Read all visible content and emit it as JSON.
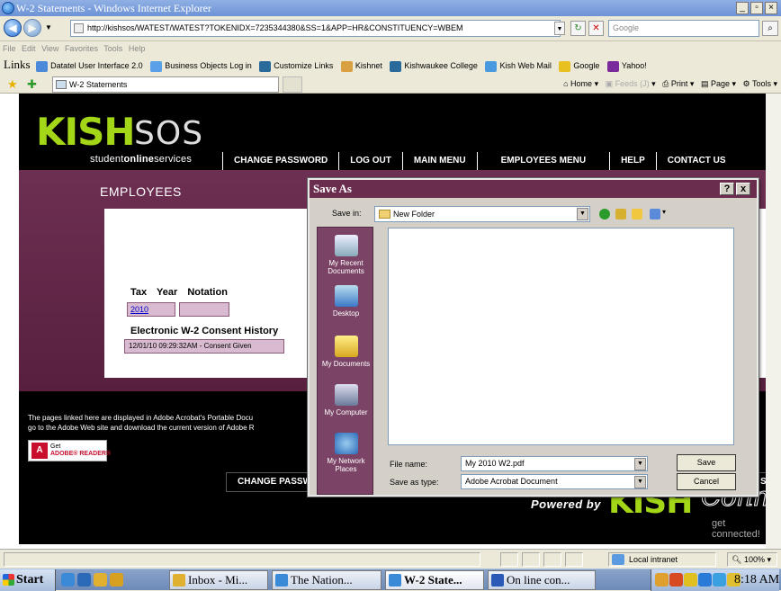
{
  "window": {
    "title": "W-2 Statements - Windows Internet Explorer",
    "controls": [
      "_",
      "̸",
      "3"
    ]
  },
  "address_bar": {
    "url": "http://kishsos/WATEST/WATEST?TOKENIDX=7235344380&SS=1&APP=HR&CONSTITUENCY=WBEM",
    "search_placeholder": "Google"
  },
  "menu": [
    "File",
    "Edit",
    "View",
    "Favorites",
    "Tools",
    "Help"
  ],
  "links_bar": {
    "label": "Links",
    "items": [
      "Datatel User Interface 2.0",
      "Business Objects Log in",
      "Customize Links",
      "Kishnet",
      "Kishwaukee College",
      "Kish Web Mail",
      "Google",
      "Yahoo!"
    ]
  },
  "tabs": {
    "active": "W-2 Statements",
    "tools": [
      "Home",
      "Feeds (J)",
      "Print",
      "Page",
      "Tools"
    ]
  },
  "site": {
    "logo_kis": "KISH",
    "logo_sos": "SOS",
    "logo_sub_a": "student",
    "logo_sub_b": "online",
    "logo_sub_c": "services",
    "nav": [
      "Change Password",
      "Log Out",
      "Main Menu",
      "Employees Menu",
      "Help",
      "Contact Us"
    ],
    "section_title": "Employees",
    "tax_year_header": "Tax Year",
    "notation_header": "Notation",
    "tax_year_value": "2010",
    "consent_header": "Electronic W-2 Consent History",
    "consent_value": "12/01/10 09:29:32AM - Consent Given",
    "footnote_line1": "The pages linked here are displayed in Adobe Acrobat's Portable Docu",
    "footnote_line2": "go to the Adobe Web site and download the current version of Adobe R",
    "adobe_get": "Get",
    "adobe_reader": "ADOBE® READER®",
    "footer_nav": "Change Passw",
    "footer_nav_tail": "S",
    "powered_by": "Powered by",
    "connect_kish": "KISH",
    "connect_word": "Connect.",
    "connect_tag": "get connected!"
  },
  "dialog": {
    "title": "Save As",
    "help_btn": "?",
    "close_btn": "x",
    "save_in_label": "Save in:",
    "save_in_value": "New Folder",
    "places": [
      "My Recent Documents",
      "Desktop",
      "My Documents",
      "My Computer",
      "My Network Places"
    ],
    "file_name_label": "File name:",
    "file_name_value": "My 2010 W2.pdf",
    "save_as_type_label": "Save as type:",
    "save_as_type_value": "Adobe Acrobat Document",
    "save_btn": "Save",
    "cancel_btn": "Cancel"
  },
  "status_bar": {
    "zone": "Local intranet",
    "zoom": "100%"
  },
  "taskbar": {
    "start": "Start",
    "buttons": [
      "Inbox - Mi...",
      "The Nation...",
      "W-2 State...",
      "On line con..."
    ],
    "clock": "8:18 AM"
  }
}
